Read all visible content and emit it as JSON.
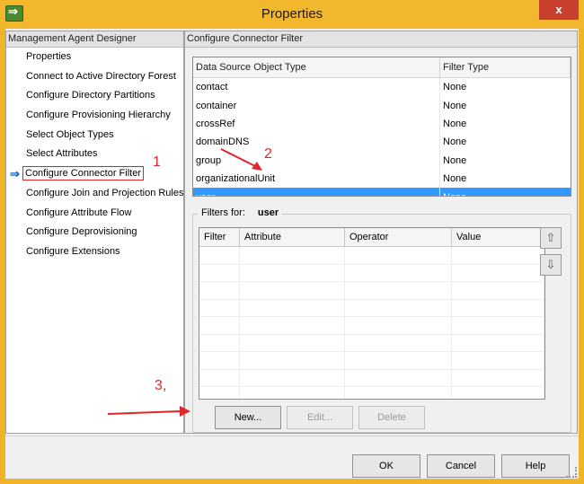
{
  "window": {
    "title": "Properties",
    "close_glyph": "x"
  },
  "left_pane": {
    "header": "Management Agent Designer",
    "items": [
      {
        "label": "Properties"
      },
      {
        "label": "Connect to Active Directory Forest"
      },
      {
        "label": "Configure Directory Partitions"
      },
      {
        "label": "Configure Provisioning Hierarchy"
      },
      {
        "label": "Select Object Types"
      },
      {
        "label": "Select Attributes"
      },
      {
        "label": "Configure Connector Filter"
      },
      {
        "label": "Configure Join and Projection Rules"
      },
      {
        "label": "Configure Attribute Flow"
      },
      {
        "label": "Configure Deprovisioning"
      },
      {
        "label": "Configure Extensions"
      }
    ],
    "active_index": 6,
    "active_arrow": "⇒"
  },
  "right_pane": {
    "header": "Configure Connector Filter",
    "object_table": {
      "columns": [
        "Data Source Object Type",
        "Filter Type"
      ],
      "rows": [
        {
          "type": "contact",
          "filter": "None"
        },
        {
          "type": "container",
          "filter": "None"
        },
        {
          "type": "crossRef",
          "filter": "None"
        },
        {
          "type": "domainDNS",
          "filter": "None"
        },
        {
          "type": "group",
          "filter": "None"
        },
        {
          "type": "organizationalUnit",
          "filter": "None"
        },
        {
          "type": "user",
          "filter": "None"
        }
      ],
      "selected_index": 6
    },
    "filters_group": {
      "label": "Filters for:",
      "value": "user",
      "columns": [
        "Filter",
        "Attribute",
        "Operator",
        "Value"
      ],
      "up_icon": "⇧",
      "down_icon": "⇩"
    },
    "buttons": {
      "new": "New...",
      "edit": "Edit...",
      "delete": "Delete"
    }
  },
  "footer": {
    "ok": "OK",
    "cancel": "Cancel",
    "help": "Help"
  },
  "annotations": {
    "one": "1",
    "two": "2",
    "three": "3,"
  },
  "colors": {
    "selection": "#3399ff",
    "title_bar": "#f2b72c",
    "annotation": "#e3242b",
    "close": "#c9402f"
  }
}
